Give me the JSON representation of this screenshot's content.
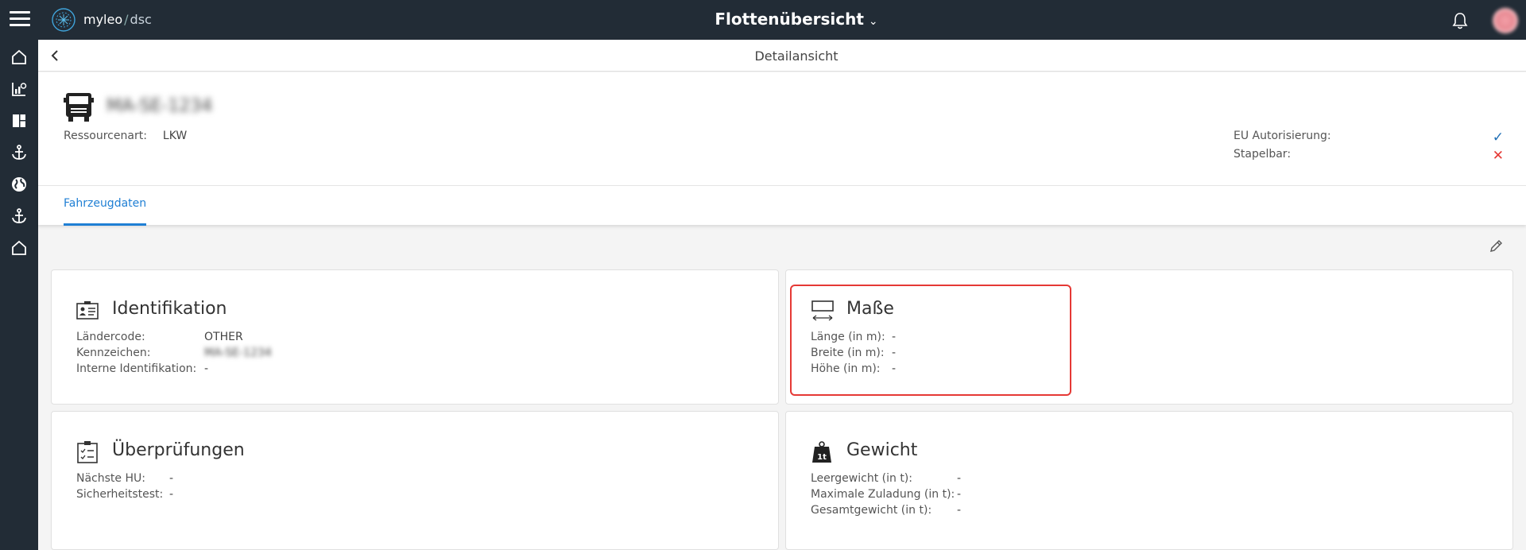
{
  "topbar": {
    "brand_main": "myleo",
    "brand_sep": "/",
    "brand_sub": "dsc",
    "title": "Flottenübersicht"
  },
  "sidenav": {
    "items": [
      "home-icon",
      "analytics-icon",
      "dashboard-icon",
      "anchor-icon",
      "globe-icon",
      "anchor-icon",
      "home-outline-icon"
    ]
  },
  "subheader": {
    "title": "Detailansicht"
  },
  "head": {
    "plate": "MA-SE-1234",
    "resource_label": "Ressourcenart:",
    "resource_value": "LKW",
    "eu_label": "EU Autorisierung:",
    "eu_icon": "✓",
    "stack_label": "Stapelbar:",
    "stack_icon": "✕",
    "check_color": "#1f6fb5",
    "cross_color": "#e53935"
  },
  "tabs": {
    "active": "Fahrzeugdaten"
  },
  "cards": {
    "ident": {
      "title": "Identifikation",
      "rows": [
        {
          "label": "Ländercode:",
          "value": "OTHER"
        },
        {
          "label": "Kennzeichen:",
          "value": "MA-SE-1234"
        },
        {
          "label": "Interne Identifikation:",
          "value": "-"
        }
      ]
    },
    "masse": {
      "title": "Maße",
      "rows": [
        {
          "label": "Länge (in m):",
          "value": "-"
        },
        {
          "label": "Breite (in m):",
          "value": "-"
        },
        {
          "label": "Höhe (in m):",
          "value": "-"
        }
      ]
    },
    "pruef": {
      "title": "Überprüfungen",
      "rows": [
        {
          "label": "Nächste HU:",
          "value": "-"
        },
        {
          "label": "Sicherheitstest:",
          "value": "-"
        }
      ]
    },
    "gewicht": {
      "title": "Gewicht",
      "rows": [
        {
          "label": "Leergewicht (in t):",
          "value": "-"
        },
        {
          "label": "Maximale Zuladung (in t):",
          "value": "-"
        },
        {
          "label": "Gesamtgewicht (in t):",
          "value": "-"
        }
      ]
    }
  }
}
